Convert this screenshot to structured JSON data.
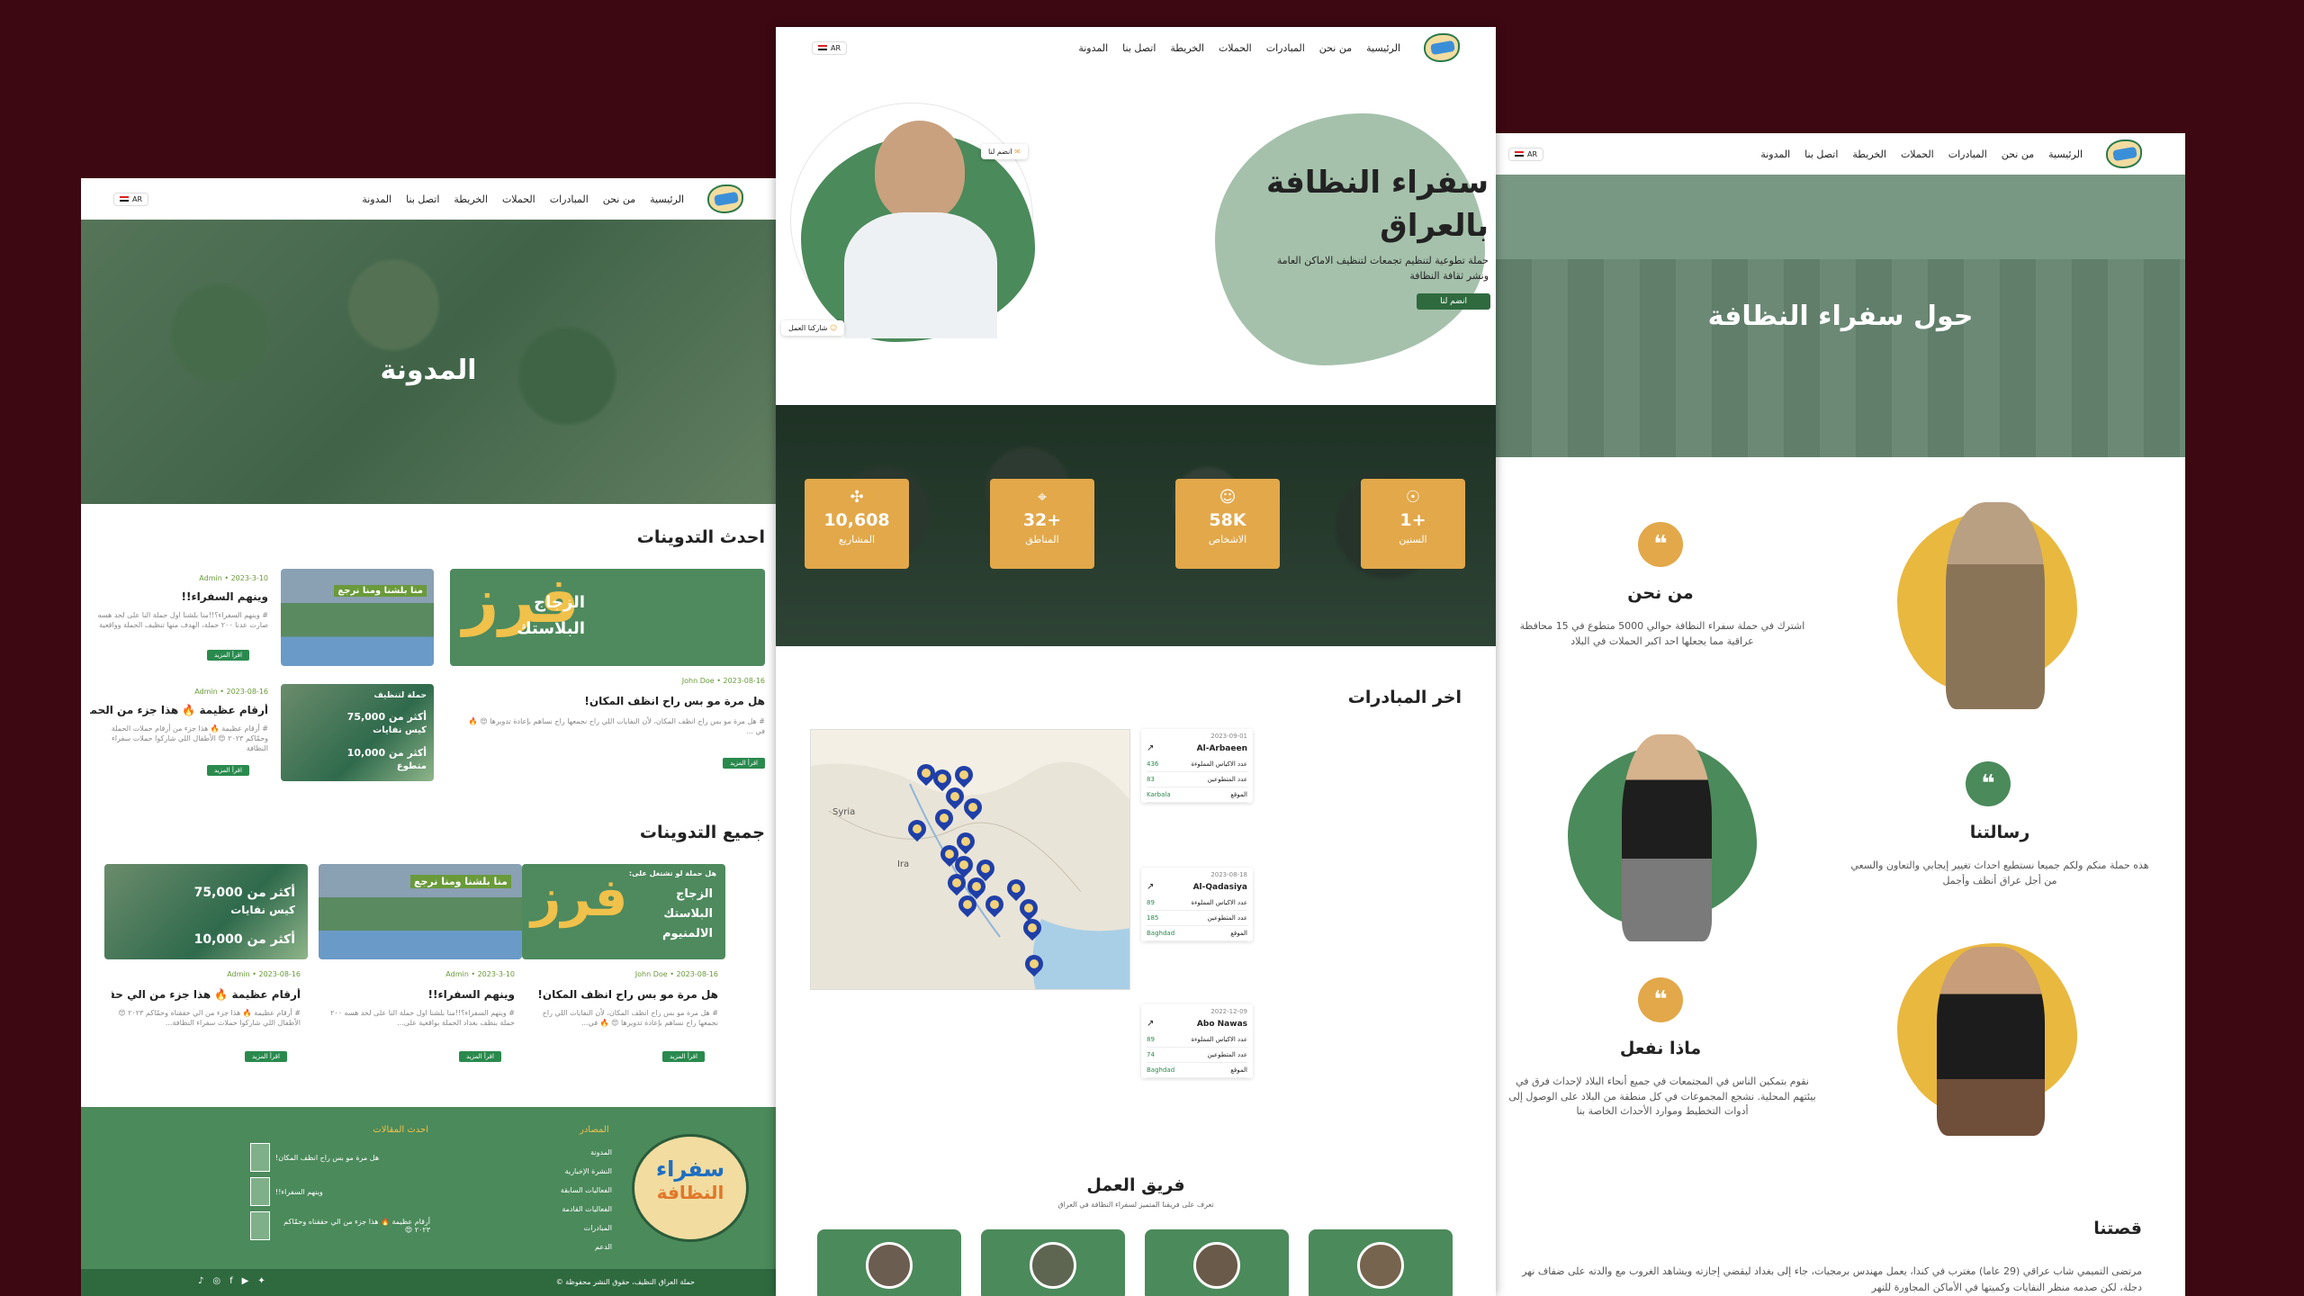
{
  "nav": {
    "home": "الرئيسية",
    "about": "من نحن",
    "initiatives": "المبادرات",
    "campaigns": "الحملات",
    "map": "الخريطة",
    "contact": "اتصل بنا",
    "blog": "المدونة",
    "lang": "AR"
  },
  "blog": {
    "hero_title": "المدونة",
    "latest_title": "احدث التدوينات",
    "all_title": "جميع التدوينات",
    "featured_caption_line1": "الزجاج",
    "featured_caption_line2": "البلاستك",
    "featured_caption_line3": "الالمنيوم",
    "featured_glyph": "فرز",
    "posts": [
      {
        "date": "2023-3-10",
        "author": "Admin",
        "title": "وينهم السفراء!!",
        "excerpt": "# وينهم السفراء؟!!منا بلشنا اول حملة النا على لحد هسه صارت عدنا ٢٠٠ حملة، الهدف منها تنظيف الحملة وواقعية",
        "read": "اقرأ المزيد",
        "caption": "منا بلشنا ومنا نرجع"
      },
      {
        "date": "2023-08-16",
        "author": "Admin",
        "title": "أرقام عظيمة 🔥 هذا جزء من الحملات...",
        "excerpt": "# أرقام عظيمة 🔥 هذا جزء من أرقام حملات الحملة وحمّاكم ٢٠٢٣ 😍 الأطفال اللي شاركوا حملات سفراء النظافة",
        "read": "اقرأ المزيد",
        "caption_a": "أكثر من 75,000",
        "caption_b": "كيس نفايات",
        "caption_c": "أكثر من 10,000",
        "caption_d": "متطوع",
        "caption_top": "حملة لتنظيف"
      },
      {
        "date": "2023-08-16",
        "author": "John Doe",
        "title": "هل مرة مو بس راح انظف المكان!",
        "excerpt": "# هل مرة مو بس راح انظف المكان، لأن النفايات اللي راح نجمعها راح نساهم بإعادة تدويرها 😍 🔥 في ...",
        "read": "اقرأ المزيد"
      }
    ],
    "all_posts": [
      {
        "date": "2023-08-16",
        "author": "John Doe",
        "title": "هل مرة مو بس راح انظف المكان!",
        "excerpt": "# هل مرة مو بس راح انظف المكان، لأن النفايات اللي راح نجمعها راح نساهم بإعادة تدويرها 😍 🔥 في...",
        "read": "اقرأ المزيد",
        "caption_top": "هل حملة لو تشتغل على:"
      },
      {
        "date": "2023-3-10",
        "author": "Admin",
        "title": "وينهم السفراء!!",
        "excerpt": "# وينهم السفراء؟!!منا بلشنا اول حملة النا على لحد هسه ٢٠٠ حملة بنظف بغداد الحملة بواقعية على...",
        "read": "اقرأ المزيد",
        "caption_top": "منا بلشنا ومنا نرجع"
      },
      {
        "date": "2023-08-16",
        "author": "Admin",
        "title": "أرقام عظيمة 🔥 هذا جزء من الي حققناه...",
        "excerpt": "# أرقام عظيمة 🔥 هذا جزء من الي حققناه وحمّاكم ٢٠٢٣ 😍 الأطفال اللي شاركوا حملات سفراء النظافة...",
        "read": "اقرأ المزيد",
        "caption_a": "أكثر من 75,000",
        "caption_b": "كيس نفايات",
        "caption_c": "أكثر من 10,000"
      }
    ]
  },
  "footer": {
    "sources_title": "المصادر",
    "sources": [
      "المدونة",
      "النشرة الإخبارية",
      "الفعاليات السابقة",
      "الفعاليات القادمة",
      "المبادرات",
      "الدعم"
    ],
    "recent_title": "احدث المقالات",
    "recent": [
      "هل مرة مو بس راح انظف المكان!",
      "وينهم السفراء!!",
      "أرقام عظيمة 🔥 هذا جزء من الي حققناه وحمّاكم ٢٠٢٣ 😍"
    ],
    "copyright": "حملة العراق النظيف، حقوق النشر محفوظة ©",
    "logo_text_1": "سفراء",
    "logo_text_2": "النظافة"
  },
  "home": {
    "hero_title_1": "سفراء النظافة",
    "hero_title_2": "بالعراق",
    "hero_desc": "حملة تطوعية لتنظيم تجمعات لتنظيف الاماكن العامة ونشر ثقافة النظافة",
    "join_btn": "انضم لنا",
    "join_badge": "انضم لنا",
    "work_badge": "شاركنا العمل",
    "stats": [
      {
        "icon": "☉",
        "value": "1+",
        "label": "السنين"
      },
      {
        "icon": "☺",
        "value": "58K",
        "label": "الاشخاص"
      },
      {
        "icon": "⌖",
        "value": "32+",
        "label": "المناطق"
      },
      {
        "icon": "✣",
        "value": "10,608",
        "label": "المشاريع"
      }
    ],
    "initiatives_title": "اخر المبادرات",
    "map_labels": {
      "syria": "Syria",
      "iraq": "Ira"
    },
    "initiatives": [
      {
        "name": "Al-Arbaeen",
        "date": "2023-09-01",
        "bags_label": "عدد الاكياس المملوءة",
        "bags": "436",
        "vol_label": "عدد المتطوعين",
        "vol": "83",
        "loc_label": "الموقع",
        "loc": "Karbala"
      },
      {
        "name": "Al-Qadasiya",
        "date": "2023-08-18",
        "bags_label": "عدد الاكياس المملوءة",
        "bags": "89",
        "vol_label": "عدد المتطوعين",
        "vol": "185",
        "loc_label": "الموقع",
        "loc": "Baghdad"
      },
      {
        "name": "Abo Nawas",
        "date": "2022-12-09",
        "bags_label": "عدد الاكياس المملوءة",
        "bags": "89",
        "vol_label": "عدد المتطوعين",
        "vol": "74",
        "loc_label": "الموقع",
        "loc": "Baghdad"
      }
    ],
    "team_title": "فريق العمل",
    "team_sub": "تعرف على فريقنا المتميز لسفراء النظافة في العراق"
  },
  "about": {
    "hero_title": "حول سفراء النظافة",
    "who_title": "من نحن",
    "who_text": "اشترك في حملة سفراء النظافة حوالي 5000 متطوع في 15 محافظة عراقية مما يجعلها احد اكبر الحملات في البلاد",
    "mission_title": "رسالتنا",
    "mission_text": "هذه حملة منكم ولكم جميعا نستطيع احداث تغيير إيجابي والتعاون والسعي من أجل عراق أنظف وأجمل",
    "what_title": "ماذا نفعل",
    "what_text": "نقوم بتمكين الناس في المجتمعات في جميع أنحاء البلاد لإحداث فرق في بيئتهم المحلية. نشجع المجموعات في كل منطقة من البلاد على الوصول إلى أدوات التخطيط وموارد الأحداث الخاصة بنا",
    "story_title": "قصتنا",
    "story_text": "مرتضى التميمي شاب عراقي (29 عاما) مغترب في كندا، يعمل مهندس برمجيات، جاء إلى بغداد ليقضي إجازته ويشاهد الغروب مع والدته على ضفاف نهر دجلة، لكن صدمه منظر النفايات وكميتها في الأماكن المجاورة للنهر"
  },
  "colors": {
    "green": "#4b8a5b",
    "amber": "#e2a84a",
    "bg": "#3d0811"
  }
}
